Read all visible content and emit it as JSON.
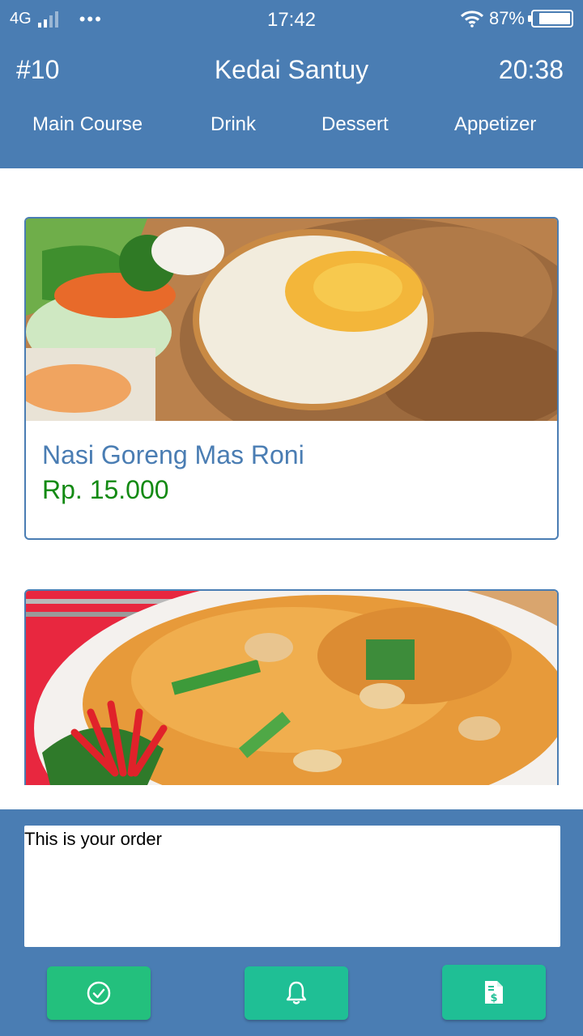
{
  "status_bar": {
    "network": "4G",
    "time": "17:42",
    "battery": "87%",
    "battery_level": 0.87
  },
  "header": {
    "table_number": "#10",
    "title": "Kedai Santuy",
    "clock": "20:38"
  },
  "tabs": [
    {
      "label": "Main Course"
    },
    {
      "label": "Drink"
    },
    {
      "label": "Dessert"
    },
    {
      "label": "Appetizer"
    }
  ],
  "menu_items": [
    {
      "name": "Nasi Goreng Mas Roni",
      "price": "Rp. 15.000",
      "image": "fried-rice-with-egg-photo"
    },
    {
      "name": "",
      "price": "",
      "image": "fried-noodles-with-chicken-photo"
    }
  ],
  "order": {
    "text": "This is your order"
  },
  "actions": [
    {
      "name": "confirm-order",
      "icon": "check-circle-icon"
    },
    {
      "name": "call-waiter",
      "icon": "bell-icon"
    },
    {
      "name": "request-bill",
      "icon": "bill-icon"
    }
  ],
  "colors": {
    "primary": "#4a7db3",
    "price": "#138a13",
    "button": "#1fbf95",
    "confirm_button": "#23c07d"
  }
}
